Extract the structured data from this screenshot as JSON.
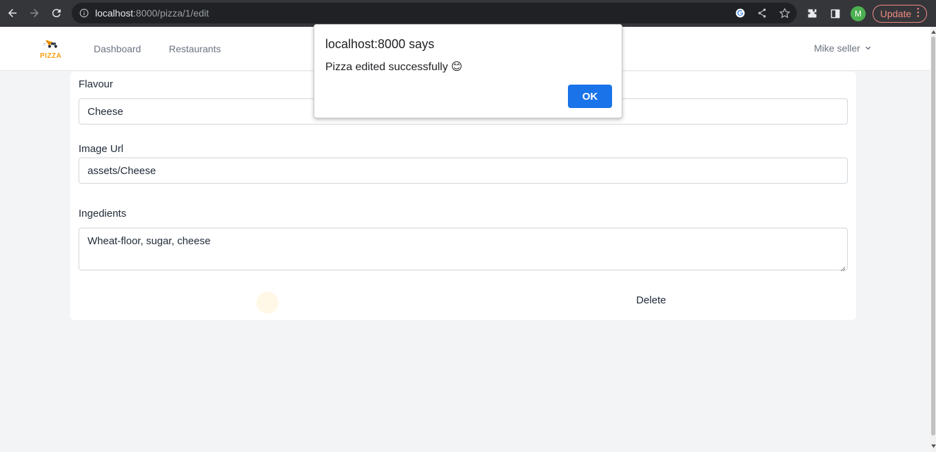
{
  "browser": {
    "url_host": "localhost",
    "url_path": ":8000/pizza/1/edit",
    "profile_initial": "M",
    "update_label": "Update",
    "colors": {
      "chrome_bg": "#35363a",
      "omnibox_bg": "#202124",
      "update": "#f28b82",
      "avatar": "#4caf50"
    }
  },
  "navbar": {
    "logo_text": "PIZZA",
    "links": [
      {
        "label": "Dashboard"
      },
      {
        "label": "Restaurants"
      }
    ],
    "user": {
      "name": "Mike seller"
    }
  },
  "form": {
    "flavour": {
      "label": "Flavour",
      "value": "Cheese"
    },
    "image_url": {
      "label": "Image Url",
      "value": "assets/Cheese"
    },
    "ingredients": {
      "label": "Ingedients",
      "value": "Wheat-floor, sugar, cheese"
    },
    "delete_label": "Delete"
  },
  "alert": {
    "title": "localhost:8000 says",
    "message": "Pizza edited successfully 😊",
    "ok_label": "OK",
    "ok_color": "#1a73e8"
  }
}
